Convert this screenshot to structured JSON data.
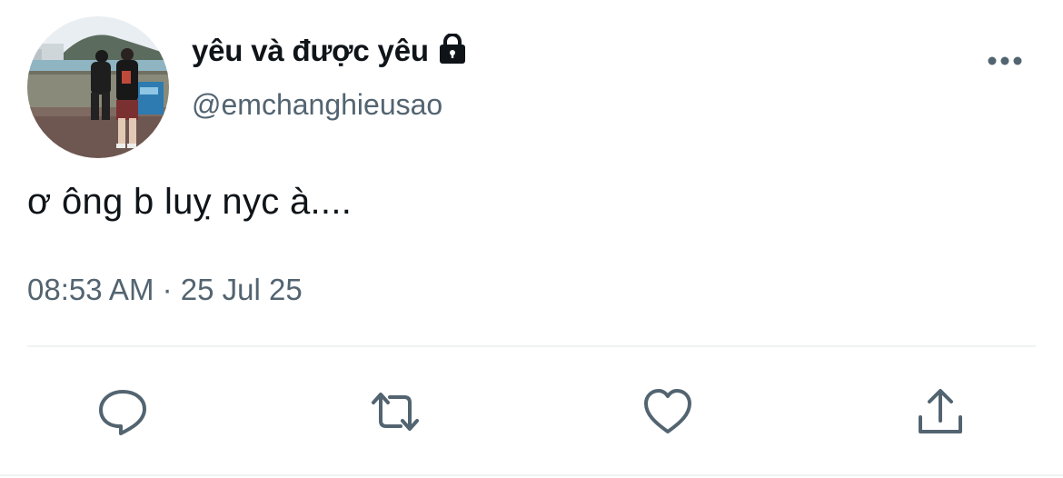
{
  "tweet": {
    "display_name": "yêu và được yêu",
    "handle": "@emchanghieusao",
    "protected": true,
    "text": "ơ ông b luỵ nyc à....",
    "time": "08:53 AM",
    "separator": " · ",
    "date": "25 Jul 25",
    "avatar_description_icon": "avatar-photo"
  },
  "icons": {
    "lock": "lock-icon",
    "more": "more-horizontal-icon",
    "reply": "reply-icon",
    "retweet": "retweet-icon",
    "like": "heart-icon",
    "share": "share-icon"
  },
  "colors": {
    "text_primary": "#0f1419",
    "text_secondary": "#536471",
    "divider": "#eff3f4",
    "icon": "#536471"
  }
}
